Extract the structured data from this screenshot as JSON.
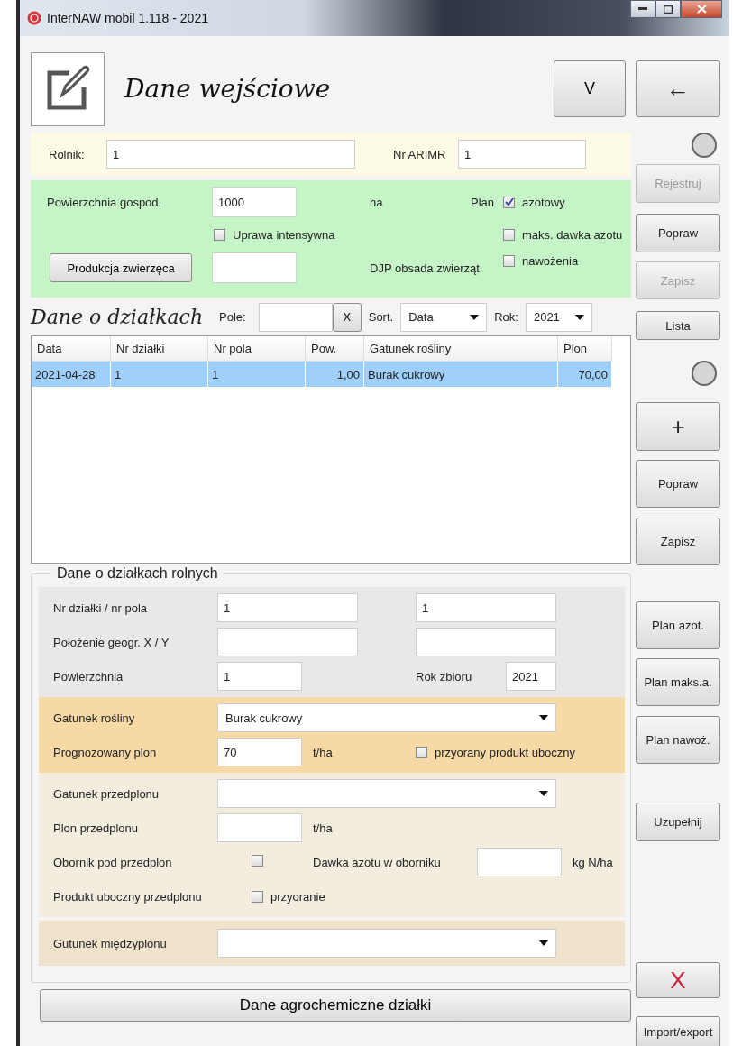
{
  "window": {
    "title": "InterNAW mobil 1.118 - 2021"
  },
  "header": {
    "title": "Dane wejściowe",
    "menu_button": "V"
  },
  "farmer": {
    "rolnik_label": "Rolnik:",
    "rolnik_value": "1",
    "arimr_label": "Nr ARIMR",
    "arimr_value": "1"
  },
  "farm": {
    "area_label": "Powierzchnia gospod.",
    "area_value": "1000",
    "area_unit": "ha",
    "intensive": {
      "label": "Uprawa intensywna",
      "checked": false
    },
    "animal_button": "Produkcja zwierzęca",
    "djp_label": "DJP obsada zwierząt",
    "plan_label": "Plan",
    "plans": [
      {
        "label": "azotowy",
        "checked": true
      },
      {
        "label": "maks. dawka azotu",
        "checked": false
      },
      {
        "label": "nawożenia",
        "checked": false
      }
    ]
  },
  "parcels": {
    "title": "Dane o działkach",
    "filter_label": "Pole:",
    "clear_button": "X",
    "sort_label": "Sort.",
    "sort_value": "Data",
    "year_label": "Rok:",
    "year_value": "2021",
    "columns": [
      "Data",
      "Nr działki",
      "Nr pola",
      "Pow.",
      "Gatunek rośliny",
      "Plon"
    ],
    "rows": [
      {
        "cells": [
          "2021-04-28",
          "1",
          "1",
          "1,00",
          "Burak cukrowy",
          "70,00"
        ],
        "selected": true
      }
    ]
  },
  "details": {
    "title": "Dane o działkach rolnych",
    "id_row": {
      "label": "Nr działki / nr pola",
      "values": [
        "1",
        "1"
      ]
    },
    "geo_row": {
      "label": "Położenie geogr. X / Y"
    },
    "area_row": {
      "label": "Powierzchnia",
      "value": "1",
      "year_label": "Rok zbioru",
      "year_value": "2021"
    },
    "crop": {
      "label": "Gatunek rośliny",
      "value": "Burak cukrowy"
    },
    "yield": {
      "label": "Prognozowany plon",
      "value": "70",
      "unit": "t/ha",
      "ploughed": {
        "label": "przyorany produkt uboczny",
        "checked": false
      }
    },
    "prev_crop": {
      "label": "Gatunek przedplonu"
    },
    "prev_yield": {
      "label": "Plon przedplonu",
      "unit": "t/ha"
    },
    "manure": {
      "label": "Obornik pod przedplon",
      "checked": false,
      "dose_label": "Dawka azotu w oborniku",
      "dose_unit": "kg N/ha"
    },
    "byproduct": {
      "label": "Produkt uboczny przedplonu",
      "ploughing": {
        "label": "przyoranie",
        "checked": false
      }
    },
    "catch_crop": {
      "label": "Gutunek międzyplonu"
    }
  },
  "bottom_button": "Dane agrochemiczne działki",
  "side": [
    {
      "kind": "button",
      "label": "←",
      "disabled": false
    },
    {
      "kind": "indicator"
    },
    {
      "kind": "button",
      "label": "Rejestruj",
      "disabled": true
    },
    {
      "kind": "button",
      "label": "Popraw",
      "disabled": false
    },
    {
      "kind": "button",
      "label": "Zapisz",
      "disabled": true
    },
    {
      "kind": "button",
      "label": "Lista",
      "disabled": false
    },
    {
      "kind": "indicator"
    },
    {
      "kind": "button",
      "label": "+",
      "disabled": false
    },
    {
      "kind": "button",
      "label": "Popraw",
      "disabled": false
    },
    {
      "kind": "button",
      "label": "Zapisz",
      "disabled": false
    },
    {
      "kind": "button",
      "label": "Plan azot.",
      "disabled": false
    },
    {
      "kind": "button",
      "label": "Plan maks.a.",
      "disabled": false
    },
    {
      "kind": "button",
      "label": "Plan nawoż.",
      "disabled": false
    },
    {
      "kind": "button",
      "label": "Uzupełnij",
      "disabled": false
    },
    {
      "kind": "delete",
      "label": "X",
      "disabled": false
    },
    {
      "kind": "button",
      "label": "Import/export",
      "disabled": false
    }
  ]
}
